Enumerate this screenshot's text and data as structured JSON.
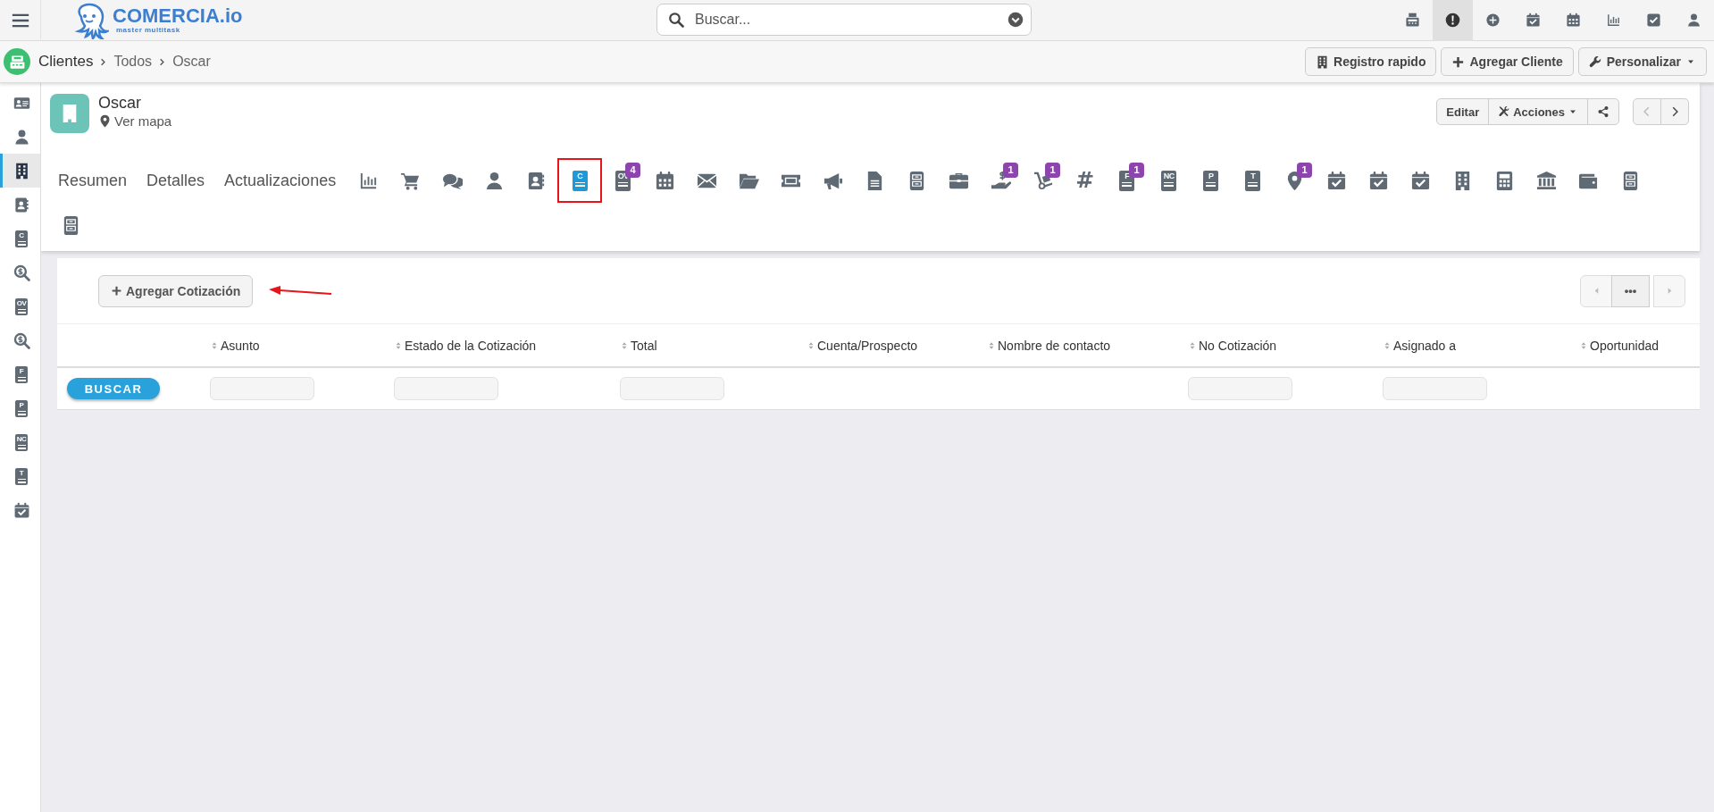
{
  "topbar": {
    "logo": "COMERCIA.io",
    "tagline": "master multitask",
    "search": {
      "placeholder": "Buscar..."
    },
    "icons": [
      {
        "kind": "fax",
        "selected": false
      },
      {
        "kind": "alert",
        "selected": true
      },
      {
        "kind": "plus",
        "selected": false
      },
      {
        "kind": "calcheck",
        "selected": false
      },
      {
        "kind": "calendar",
        "selected": false
      },
      {
        "kind": "chart",
        "selected": false
      },
      {
        "kind": "checkbox",
        "selected": false
      },
      {
        "kind": "person",
        "selected": false
      }
    ]
  },
  "breadcrumb": {
    "items": [
      "Clientes",
      "Todos",
      "Oscar"
    ],
    "buttons": [
      {
        "kind": "building",
        "label": "Registro rapido"
      },
      {
        "kind": "plus",
        "label": "Agregar Cliente"
      },
      {
        "kind": "wrench",
        "label": "Personalizar",
        "caret": true
      }
    ]
  },
  "sidebar": {
    "items": [
      {
        "kind": "idcard",
        "selected": false
      },
      {
        "kind": "person",
        "selected": false
      },
      {
        "kind": "building",
        "selected": true
      },
      {
        "kind": "contacts",
        "selected": false
      },
      {
        "kind": "doc",
        "letter": "C",
        "selected": false
      },
      {
        "kind": "searchdollar",
        "selected": false
      },
      {
        "kind": "doc",
        "letter": "OV",
        "selected": false
      },
      {
        "kind": "searchdollar",
        "selected": false
      },
      {
        "kind": "doc",
        "letter": "F",
        "selected": false
      },
      {
        "kind": "doc",
        "letter": "P",
        "selected": false
      },
      {
        "kind": "doc",
        "letter": "NC",
        "selected": false
      },
      {
        "kind": "doc",
        "letter": "T",
        "selected": false
      },
      {
        "kind": "calcheck",
        "selected": false
      }
    ]
  },
  "record": {
    "name": "Oscar",
    "map_link": "Ver mapa",
    "actions": [
      {
        "kind": "text",
        "label": "Editar"
      },
      {
        "kind": "menu",
        "label": "Acciones"
      },
      {
        "kind": "share"
      }
    ],
    "pager": [
      {
        "kind": "prev",
        "disabled": true
      },
      {
        "kind": "next",
        "disabled": false
      }
    ],
    "text_tabs": [
      {
        "label": "Resumen",
        "selected": false
      },
      {
        "label": "Detalles",
        "selected": false
      },
      {
        "label": "Actualizaciones",
        "selected": false
      }
    ],
    "icon_tabs": [
      {
        "kind": "chart",
        "selected": false,
        "marked": false
      },
      {
        "kind": "cart",
        "selected": false,
        "marked": false
      },
      {
        "kind": "comments",
        "selected": false,
        "marked": false
      },
      {
        "kind": "person",
        "selected": false,
        "marked": false
      },
      {
        "kind": "contacts",
        "selected": false,
        "marked": false
      },
      {
        "kind": "doc",
        "letter": "C",
        "selected": true,
        "marked": true
      },
      {
        "kind": "doc",
        "letter": "OV",
        "badge": "4",
        "selected": false,
        "marked": false
      },
      {
        "kind": "calendar",
        "selected": false,
        "marked": false
      },
      {
        "kind": "envelope",
        "selected": false,
        "marked": false
      },
      {
        "kind": "folder",
        "selected": false,
        "marked": false
      },
      {
        "kind": "ticket",
        "selected": false,
        "marked": false
      },
      {
        "kind": "bullhorn",
        "selected": false,
        "marked": false
      },
      {
        "kind": "file",
        "selected": false,
        "marked": false
      },
      {
        "kind": "cabinet",
        "selected": false,
        "marked": false
      },
      {
        "kind": "briefcase",
        "selected": false,
        "marked": false
      },
      {
        "kind": "handdollar",
        "badge": "1",
        "selected": false,
        "marked": false
      },
      {
        "kind": "dolly",
        "badge": "1",
        "selected": false,
        "marked": false
      },
      {
        "kind": "hash",
        "char": "#",
        "selected": false,
        "marked": false
      },
      {
        "kind": "doc",
        "letter": "F",
        "badge": "1",
        "selected": false,
        "marked": false
      },
      {
        "kind": "doc",
        "letter": "NC",
        "selected": false,
        "marked": false
      },
      {
        "kind": "doc",
        "letter": "P",
        "selected": false,
        "marked": false
      },
      {
        "kind": "doc",
        "letter": "T",
        "selected": false,
        "marked": false
      },
      {
        "kind": "marker",
        "badge": "1",
        "selected": false,
        "marked": false
      },
      {
        "kind": "calcheck",
        "selected": false,
        "marked": false
      },
      {
        "kind": "calcheck",
        "selected": false,
        "marked": false
      },
      {
        "kind": "calcheck",
        "selected": false,
        "marked": false
      },
      {
        "kind": "building",
        "selected": false,
        "marked": false
      },
      {
        "kind": "calculator",
        "selected": false,
        "marked": false
      },
      {
        "kind": "bank",
        "selected": false,
        "marked": false
      },
      {
        "kind": "wallet",
        "selected": false,
        "marked": false
      },
      {
        "kind": "cabinet",
        "selected": false,
        "marked": false
      },
      {
        "kind": "cabinet",
        "selected": false,
        "marked": false
      }
    ]
  },
  "quotes": {
    "add_button": "Agregar Cotización",
    "annotation": {
      "kind": "arrow"
    },
    "pager": [
      {
        "kind": "prev",
        "disabled": true
      },
      {
        "kind": "more",
        "label": "•••",
        "disabled": false
      },
      {
        "kind": "next",
        "disabled": true
      }
    ],
    "table": {
      "columns": [
        "Asunto",
        "Estado de la Cotización",
        "Total",
        "Cuenta/Prospecto",
        "Nombre de contacto",
        "No Cotización",
        "Asignado a",
        "Oportunidad"
      ],
      "search_button": "BUSCAR",
      "filters": [
        true,
        true,
        true,
        false,
        false,
        true,
        true,
        false
      ]
    }
  }
}
